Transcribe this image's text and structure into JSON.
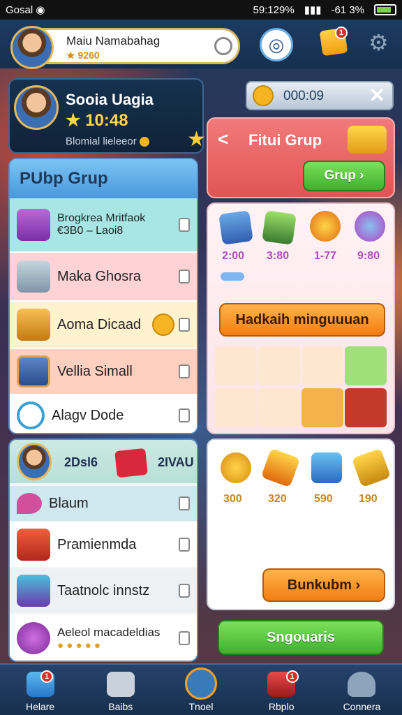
{
  "status": {
    "carrier": "Gosal",
    "clock": "59:129%",
    "battery": "-61 3%"
  },
  "topbar": {
    "name": "Maiu Namabahag",
    "coins": "★ 9260",
    "notif_count": "1"
  },
  "user_card": {
    "name": "Sooia Uagia",
    "score": "★ 10:48",
    "label": "Blomial lieleeor"
  },
  "timer": {
    "value": "000:09",
    "close": "✕"
  },
  "group_panel": {
    "header": "PUbp Grup",
    "rows": [
      {
        "label": "Brogkrea Mritfaok",
        "sub": "€3B0 – Laoi8",
        "color": "#a8e6e6",
        "icon": "chest-purple"
      },
      {
        "label": "Maka Ghosra",
        "color": "#ffd3d6",
        "icon": "chest-steel"
      },
      {
        "label": "Aoma Dicaad",
        "color": "#fff3cf",
        "icon": "chest-gold"
      },
      {
        "label": "Vellia Simall",
        "color": "#ffd0bf",
        "icon": "card-scroll"
      },
      {
        "label": "Alagv Dode",
        "color": "#ffffff",
        "icon": "chat-bubble"
      }
    ]
  },
  "group_panel2": {
    "top_left": "2Dsl6",
    "top_right": "2IVAU",
    "rows": [
      {
        "label": "Blaum",
        "color": "#cfe7ee"
      },
      {
        "label": "Pramienmda",
        "color": "#ffffff"
      },
      {
        "label": "Taatnolc innstz",
        "color": "#eef1f3"
      },
      {
        "label": "Aeleol macadeldias",
        "color": "#ffffff"
      }
    ]
  },
  "fitui_panel": {
    "title": "Fitui Grup",
    "back": "<",
    "grup_btn": "Grup ›"
  },
  "rewards1": {
    "values": [
      "2:00",
      "3:80",
      "1-77",
      "9:80"
    ],
    "cta": "Hadkaih minguuuan"
  },
  "rewards2": {
    "values": [
      "300",
      "320",
      "590",
      "190"
    ],
    "cta": "Bunkubm ›"
  },
  "bottom_cta": "Sngouaris",
  "nav": [
    {
      "label": "Helare",
      "badge": "1"
    },
    {
      "label": "Baibs"
    },
    {
      "label": "Tnoel"
    },
    {
      "label": "Rbplo",
      "badge": "1"
    },
    {
      "label": "Connera"
    }
  ]
}
